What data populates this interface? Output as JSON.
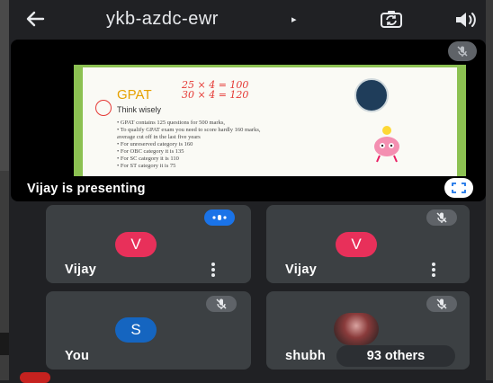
{
  "meeting": {
    "code": "ykb-azdc-ewr",
    "caret": "▸"
  },
  "stage": {
    "presenter_label": "Vijay is presenting",
    "slide": {
      "title": "GPAT",
      "subtitle": "Think wisely",
      "ink_lines": [
        "25 × 4 = 100",
        "30 × 4 = 120"
      ],
      "bullets": [
        "• GPAT contains 125 questions for 500 marks,",
        "• To qualify GPAT exam you need to score hardly 160 marks,",
        "  average cut off in the last five years",
        "• For unreserved category is 160",
        "• For OBC category it is 135",
        "• For SC category it is 110",
        "• For ST category it is 75"
      ]
    }
  },
  "tiles": [
    {
      "initial": "V",
      "name": "Vijay",
      "status": "speaking"
    },
    {
      "initial": "V",
      "name": "Vijay",
      "status": "muted"
    },
    {
      "initial": "S",
      "name": "You",
      "status": "muted"
    },
    {
      "name": "shubh",
      "others_label": "93 others",
      "status": "muted"
    }
  ],
  "colors": {
    "background": "#202124",
    "tile": "#3c4043",
    "avatar_vijay": "#e8305a",
    "avatar_you": "#1565c0",
    "speaking_indicator": "#1a73e8"
  }
}
